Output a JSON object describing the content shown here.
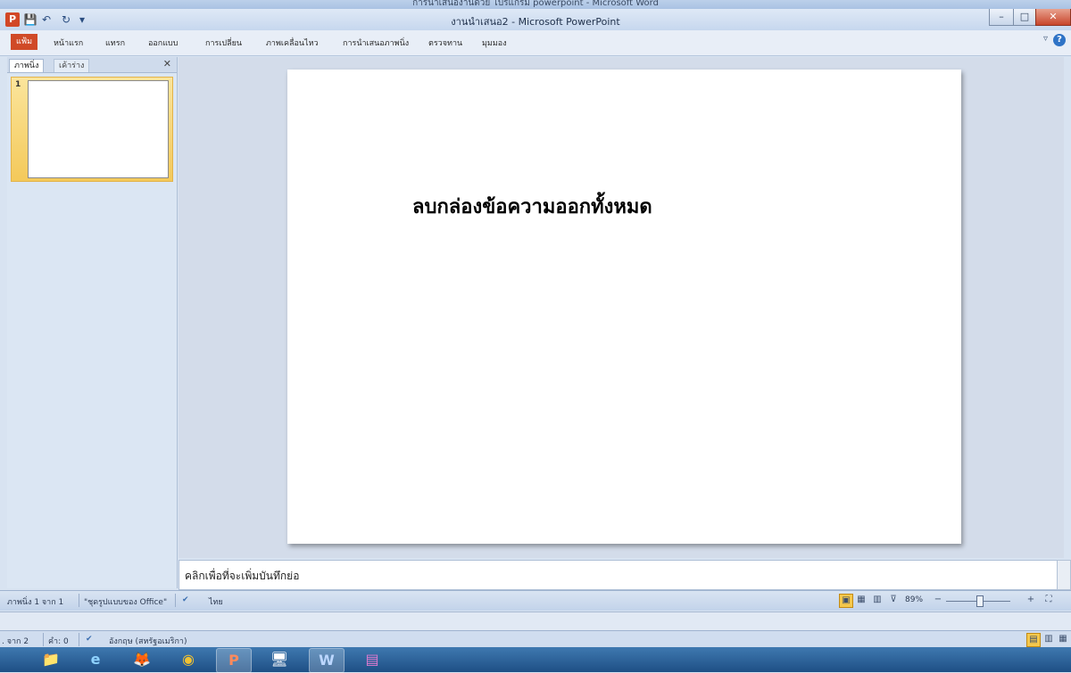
{
  "background_window": {
    "title": "การนำเสนองานด้วย โปรแกรม powerpoint - Microsoft Word"
  },
  "titlebar": {
    "title": "งานนำเสนอ2 - Microsoft PowerPoint",
    "app_icon": "P",
    "save_icon": "💾",
    "undo_icon": "↶",
    "redo_icon": "↻",
    "customize_icon": "▾",
    "minimize_icon": "–",
    "maximize_icon": "□",
    "close_icon": "✕"
  },
  "ribbon": {
    "tabs": [
      "แฟ้ม",
      "หน้าแรก",
      "แทรก",
      "ออกแบบ",
      "การเปลี่ยน",
      "ภาพเคลื่อนไหว",
      "การนำเสนอภาพนิ่ง",
      "ตรวจทาน",
      "มุมมอง"
    ],
    "help_icon": "?",
    "minimize_ribbon_icon": "▿"
  },
  "left_pane": {
    "tab_slides": "ภาพนิ่ง",
    "tab_outline": "เค้าร่าง",
    "close_icon": "✕",
    "slide_number": "1"
  },
  "slide": {
    "text": "ลบกล่องข้อความออกทั้งหมด"
  },
  "notes": {
    "placeholder": "คลิกเพื่อที่จะเพิ่มบันทึกย่อ"
  },
  "statusbar": {
    "slide_info": "ภาพนิ่ง 1 จาก 1",
    "theme": "\"ชุดรูปแบบของ Office\"",
    "language": "ไทย",
    "zoom": "89%",
    "zoom_out": "−",
    "zoom_in": "+",
    "fit_icon": "⛶"
  },
  "word_status": {
    "pages": ". จาก 2",
    "words": "คำ: 0",
    "language": "อังกฤษ (สหรัฐอเมริกา)"
  },
  "taskbar": {
    "items": [
      "📁",
      "e",
      "🦊",
      "◉",
      "P",
      "🖥",
      "W",
      "▤"
    ]
  }
}
